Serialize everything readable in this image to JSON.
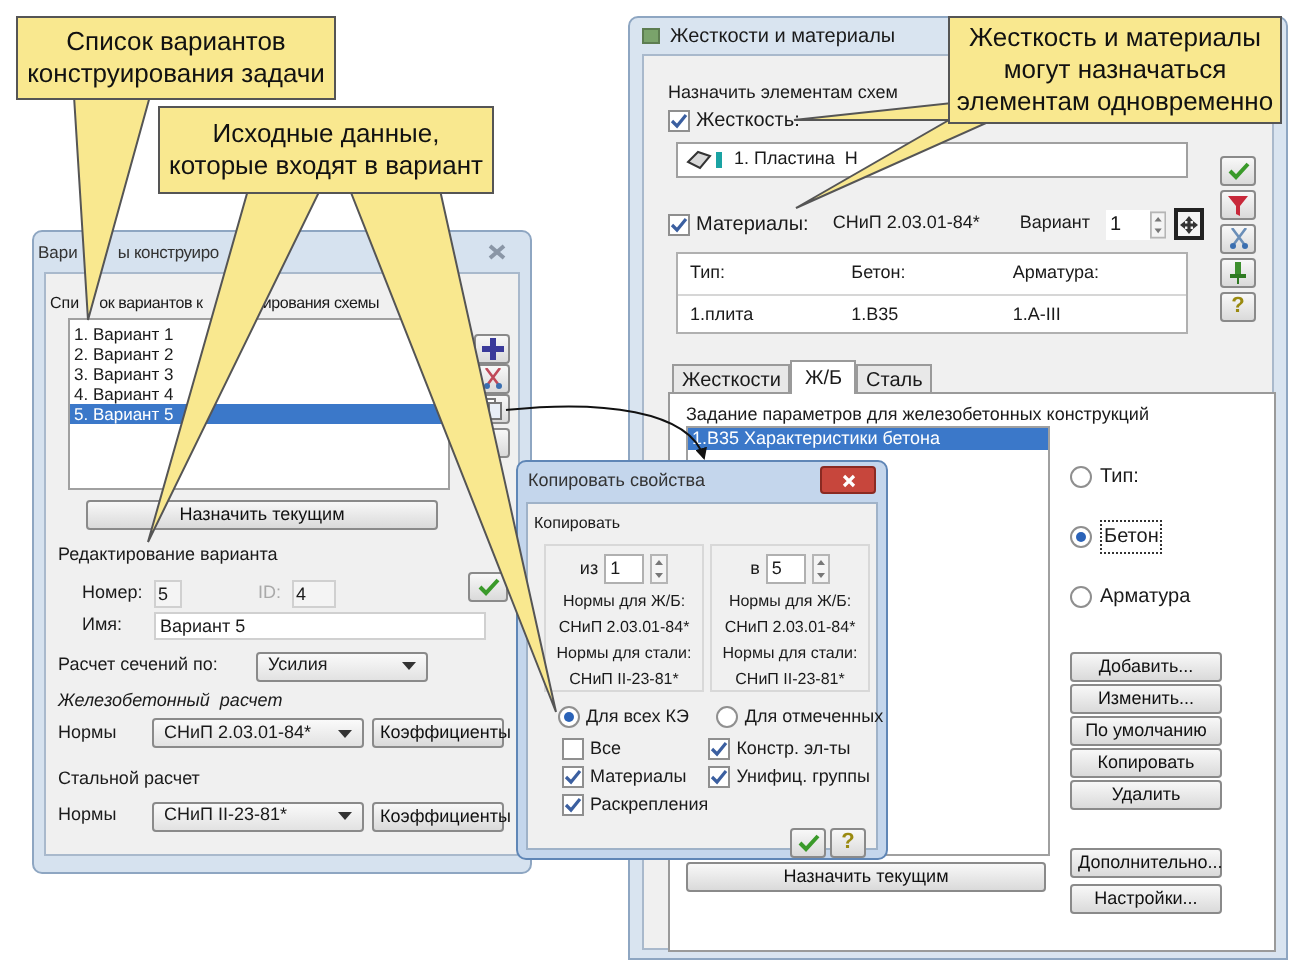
{
  "callouts": [
    {
      "lines": [
        "Список вариантов",
        "конструирования задачи"
      ]
    },
    {
      "lines": [
        "Исходные данные,",
        "которые входят в вариант"
      ]
    },
    {
      "lines": [
        "Жесткость и материалы",
        "могут назначаться",
        "элементам одновременно"
      ]
    }
  ],
  "stiffness_window": {
    "title": "Жесткости и материалы",
    "assign_label": "Назначить элементам схем",
    "stiffness": {
      "label": "Жесткость:",
      "checked": true
    },
    "stiffness_item": "1. Пластина  Н",
    "materials": {
      "label": "Материалы:",
      "checked": true
    },
    "materials_norms": "СНиП 2.03.01-84*",
    "variant_label": "Вариант",
    "variant_value": "1",
    "table": {
      "columns": [
        "Тип:",
        "Бетон:",
        "Арматура:"
      ],
      "rows": [
        [
          "1.плита",
          "1.B35",
          "1.A-III"
        ]
      ]
    },
    "help_button": "?",
    "tabs": [
      {
        "label": "Жесткости",
        "selected": false
      },
      {
        "label": "Ж/Б",
        "selected": true
      },
      {
        "label": "Сталь",
        "selected": false
      }
    ],
    "panel_title": "Задание параметров для железобетонных конструкций",
    "list": [
      {
        "label": "1.В35 Характеристики бетона",
        "selected": true
      }
    ],
    "radios": [
      {
        "label": "Тип:",
        "selected": false
      },
      {
        "label": "Бетон",
        "selected": true
      },
      {
        "label": "Арматура",
        "selected": false
      }
    ],
    "buttons": [
      "Добавить...",
      "Изменить...",
      "По умолчанию",
      "Копировать",
      "Удалить"
    ],
    "extra_buttons": [
      "Дополнительно...",
      "Настройки..."
    ],
    "assign_button": "Назначить текущим"
  },
  "variants_window": {
    "title_parts": [
      "Вари",
      "ы конструиро"
    ],
    "list_label_parts": [
      "Спи",
      "ок вариантов к",
      "ирования схемы"
    ],
    "variants": [
      {
        "label": "1. Вариант 1",
        "selected": false
      },
      {
        "label": "2. Вариант 2",
        "selected": false
      },
      {
        "label": "3. Вариант 3",
        "selected": false
      },
      {
        "label": "4. Вариант 4",
        "selected": false
      },
      {
        "label": "5. Вариант 5",
        "selected": true
      }
    ],
    "assign_button": "Назначить текущим",
    "edit_section": "Редактирование варианта",
    "number_label": "Номер:",
    "number_value": "5",
    "id_label": "ID:",
    "id_value": "4",
    "name_label": "Имя:",
    "name_value": "Вариант 5",
    "calc_label": "Расчет сечений по:",
    "calc_value": "Усилия",
    "rc_section": "Железобетонный  расчет",
    "rc_norms_label": "Нормы",
    "rc_norms_value": "СНиП 2.03.01-84*",
    "rc_coeff_button": "Коэффициенты",
    "steel_section": "Стальной расчет",
    "steel_norms_label": "Нормы",
    "steel_norms_value": "СНиП II-23-81*",
    "steel_coeff_button": "Коэффициенты"
  },
  "copy_dialog": {
    "title": "Копировать свойства",
    "group": "Копировать",
    "sources": [
      {
        "label": "из",
        "value": "1",
        "rc_label": "Нормы для Ж/Б:",
        "rc_value": "СНиП 2.03.01-84*",
        "steel_label": "Нормы для стали:",
        "steel_value": "СНиП II-23-81*"
      },
      {
        "label": "в",
        "value": "5",
        "rc_label": "Нормы для Ж/Б:",
        "rc_value": "СНиП 2.03.01-84*",
        "steel_label": "Нормы для стали:",
        "steel_value": "СНиП II-23-81*"
      }
    ],
    "scope": [
      {
        "label": "Для всех КЭ",
        "selected": true
      },
      {
        "label": "Для отмеченных",
        "selected": false
      }
    ],
    "options_left": [
      {
        "label": "Все",
        "checked": false
      },
      {
        "label": "Материалы",
        "checked": true
      },
      {
        "label": "Раскрепления",
        "checked": true
      }
    ],
    "options_right": [
      {
        "label": "Констр. эл-ты",
        "checked": true
      },
      {
        "label": "Унифиц. группы",
        "checked": true
      }
    ],
    "help_button": "?"
  }
}
